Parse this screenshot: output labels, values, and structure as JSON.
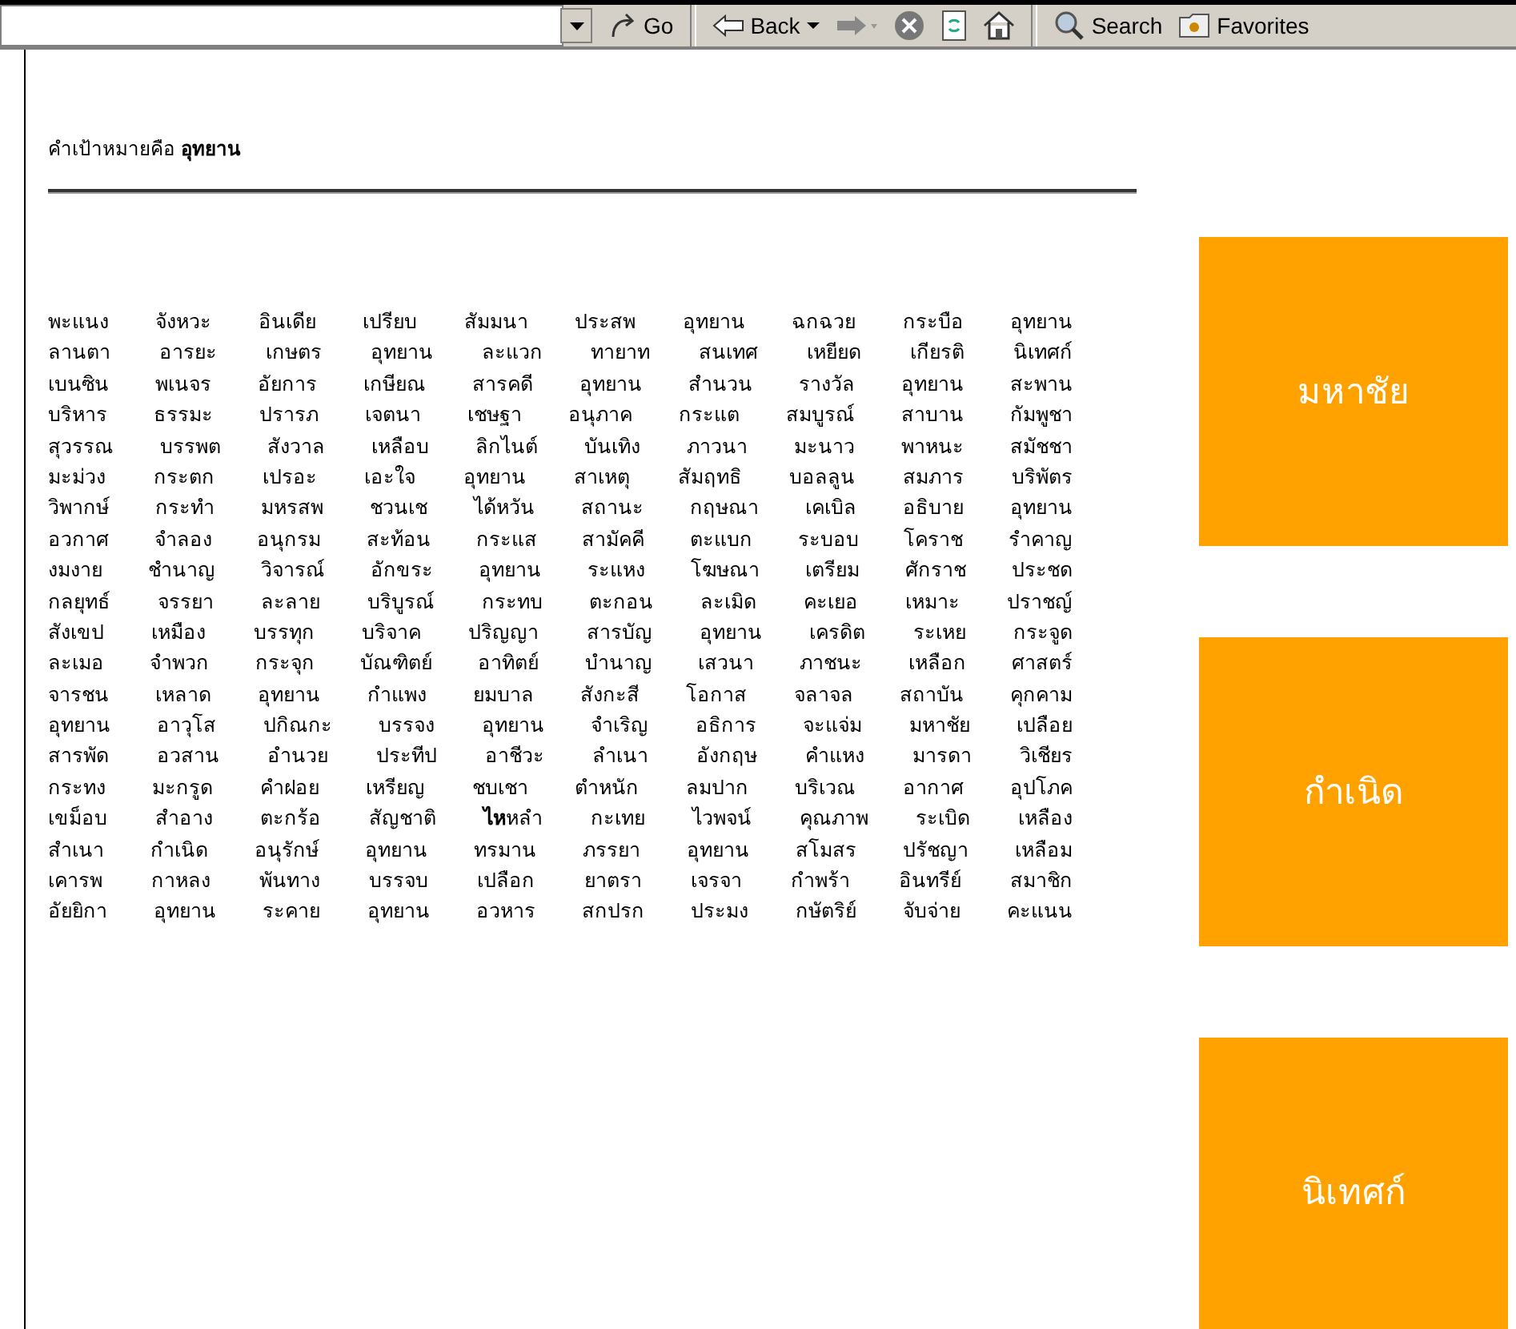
{
  "toolbar": {
    "items": [
      {
        "kind": "dropdown"
      },
      {
        "kind": "go",
        "label": "Go"
      },
      {
        "kind": "separator"
      },
      {
        "kind": "back",
        "label": "Back"
      },
      {
        "kind": "forward"
      },
      {
        "kind": "stop"
      },
      {
        "kind": "refresh"
      },
      {
        "kind": "home"
      },
      {
        "kind": "separator"
      },
      {
        "kind": "search",
        "label": "Search"
      },
      {
        "kind": "favorites",
        "label": "Favorites"
      }
    ]
  },
  "heading": "คำเป้าหมายคือ **อุทยาน**",
  "lines": [
    "พะแนง จังหวะ อินเดีย เปรียบ สัมมนา ประสพ อุทยาน ฉกฉวย กระบือ อุทยาน",
    "ลานตา อารยะ เกษตร อุทยาน ละแวก ทายาท สนเทศ เหยียด เกียรติ นิเทศก์",
    "เบนซิน พเนจร อัยการ เกษียณ สารคดี อุทยาน สำนวน รางวัล อุทยาน สะพาน",
    "บริหาร ธรรมะ ปรารภ เจตนา เชษฐา อนุภาค กระแต สมบูรณ์ สาบาน กัมพูชา",
    "สุวรรณ บรรพต สังวาล เหลือบ ลิกไนต์ บันเทิง ภาวนา มะนาว พาหนะ สมัชชา",
    "มะม่วง กระตก เปรอะ เอะใจ อุทยาน สาเหตุ สัมฤทธิ บอลลูน สมภาร บริพัตร",
    "วิพากษ์ กระทำ มหรสพ ชวนเช ได้หวัน สถานะ กฤษณา เคเบิล อธิบาย อุทยาน",
    "อวกาศ จำลอง อนุกรม สะท้อน กระแส สามัคคี ตะแบก ระบอบ โคราช รำคาญ",
    "งมงาย ชำนาญ วิจารณ์ อักขระ อุทยาน ระแหง โฆษณา เตรียม ศักราช ประชด",
    "กลยุทธ์ จรรยา ละลาย บริบูรณ์ กระทบ ตะกอน ละเมิด คะเยอ เหมาะ ปราชญ์",
    "สังเขป เหมือง บรรทุก บริจาค ปริญญา สารบัญ อุทยาน เครดิต ระเหย กระจูด",
    "ละเมอ จำพวก กระจุก บัณฑิตย์ อาทิตย์ บำนาญ เสวนา ภาชนะ เหลือก ศาสตร์",
    "จารชน เหลาด อุทยาน กำแพง ยมบาล สังกะสี โอกาส จลาจล สถาบัน คุกคาม",
    "อุทยาน อาวุโส ปกิณกะ บรรจง อุทยาน จำเริญ อธิการ จะแจ่ม มหาชัย เปลือย",
    "สารพัด อวสาน อำนวย ประทีป อาชีวะ ลำเนา อังกฤษ คำแหง มารดา วิเชียร",
    "กระทง มะกรูด คำฝอย เหรียญ ชบเชา ตำหนัก ลมปาก บริเวณ อากาศ อุปโภค",
    "เขม็อบ สำอาง ตะกร้อ สัญชาติ **ไห**หลำ กะเทย ไวพจน์ คุณภาพ ระเบิด เหลือง",
    "สำเนา กำเนิด อนุรักษ์ อุทยาน ทรมาน ภรรยา อุทยาน สโมสร ปรัชญา เหลือม",
    "เคารพ กาหลง พันทาง บรรจบ เปลือก ยาตรา เจรจา กำพร้า อินทรีย์ สมาชิก",
    "อัยยิกา อุทยาน ระคาย อุทยาน อวหาร สกปรก ประมง กษัตริย์ จับจ่าย คะแนน"
  ],
  "tiles": [
    "มหาชัย",
    "กำเนิด",
    "นิเทศก์"
  ]
}
